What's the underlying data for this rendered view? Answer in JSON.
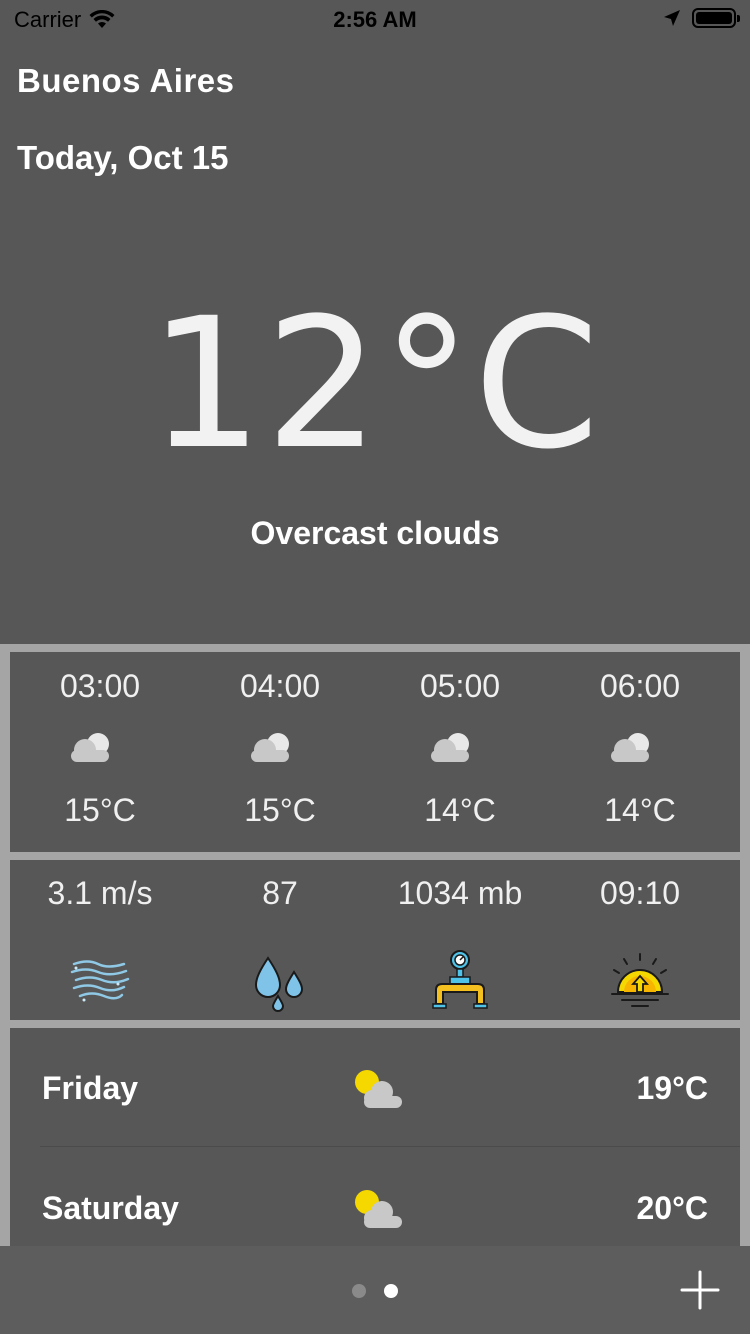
{
  "status_bar": {
    "carrier": "Carrier",
    "time": "2:56 AM"
  },
  "header": {
    "city": "Buenos Aires",
    "date": "Today, Oct 15"
  },
  "current": {
    "temperature": "12°C",
    "condition": "Overcast clouds"
  },
  "hourly": [
    {
      "time": "03:00",
      "icon": "cloud-icon",
      "temp": "15°C"
    },
    {
      "time": "04:00",
      "icon": "cloud-icon",
      "temp": "15°C"
    },
    {
      "time": "05:00",
      "icon": "cloud-icon",
      "temp": "14°C"
    },
    {
      "time": "06:00",
      "icon": "cloud-icon",
      "temp": "14°C"
    }
  ],
  "details": [
    {
      "value": "3.1 m/s",
      "icon": "wind-icon"
    },
    {
      "value": "87",
      "icon": "humidity-icon"
    },
    {
      "value": "1034 mb",
      "icon": "pressure-gauge-icon"
    },
    {
      "value": "09:10",
      "icon": "sunrise-icon"
    }
  ],
  "daily": [
    {
      "day": "Friday",
      "icon": "partly-cloudy-icon",
      "temp": "19°C"
    },
    {
      "day": "Saturday",
      "icon": "partly-cloudy-icon",
      "temp": "20°C"
    }
  ],
  "pager": {
    "pages": 2,
    "current": 2
  },
  "colors": {
    "background": "#575757",
    "panel_border": "#a5a5a5",
    "sun": "#f5d800",
    "cloud": "#c8c8c8",
    "water": "#7fc4e8",
    "pipe": "#f4c020"
  }
}
